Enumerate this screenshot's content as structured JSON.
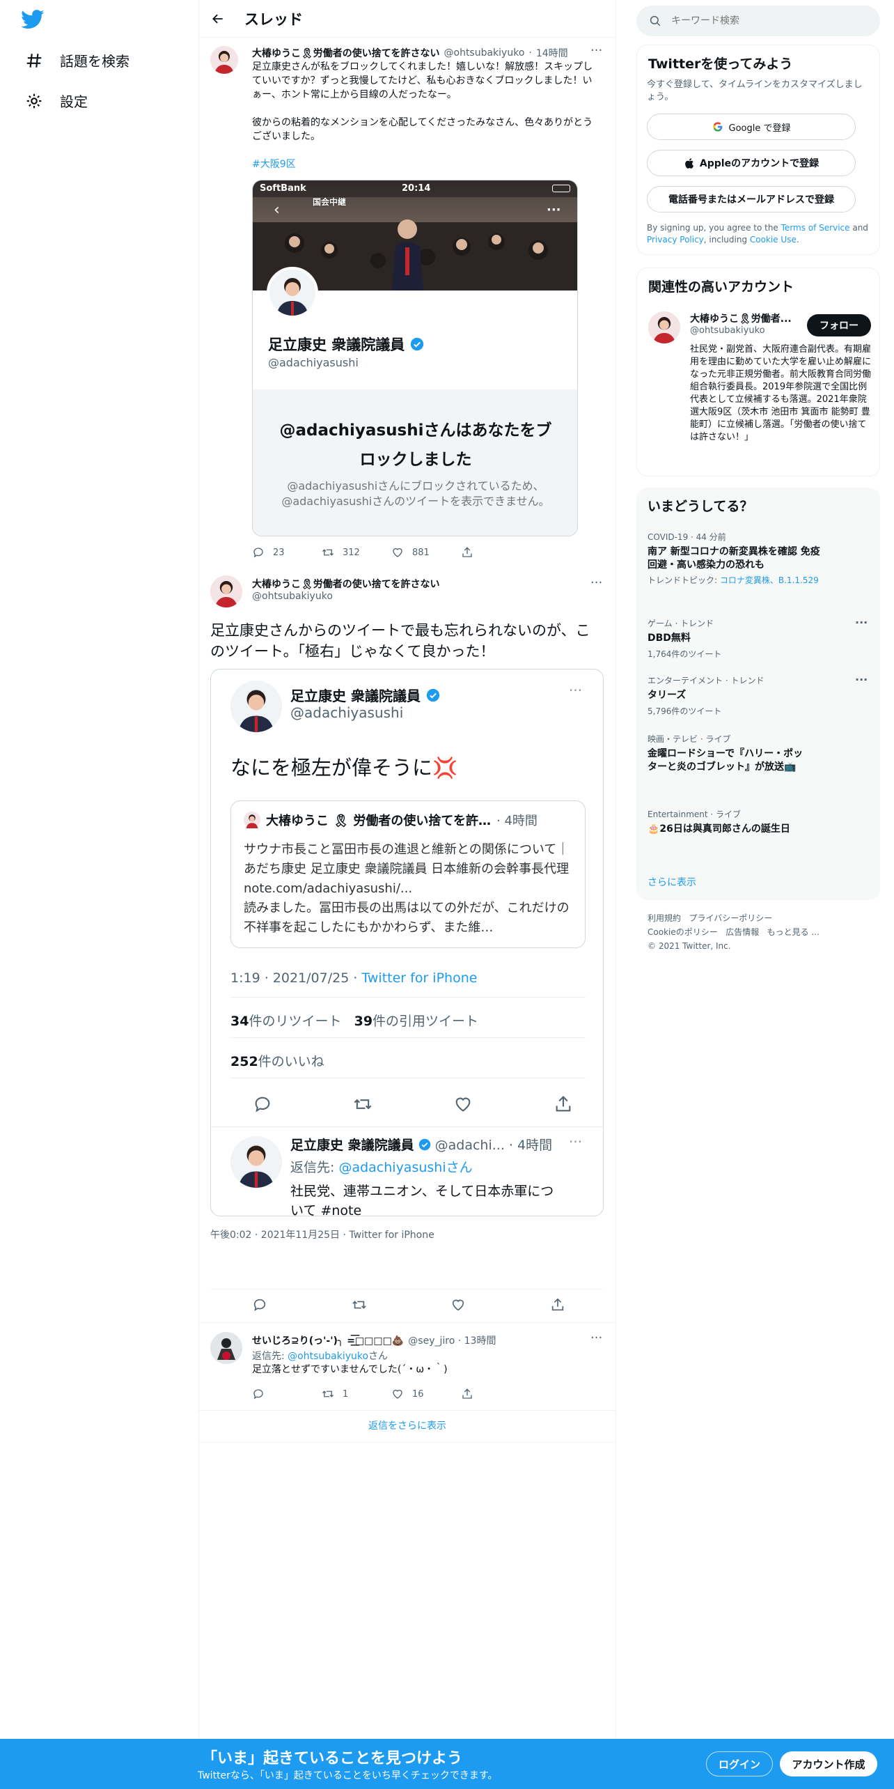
{
  "sidebar": {
    "items": [
      {
        "label": "話題を検索"
      },
      {
        "label": "設定"
      }
    ]
  },
  "header": {
    "title": "スレッド"
  },
  "tweet1": {
    "author": "大椿ゆうこ🎗労働者の使い捨てを許さない",
    "handle": "@ohtsubakiyuko",
    "time": "14時間",
    "text": "足立康史さんが私をブロックしてくれました！嬉しいな！解放感！スキップしていいですか？ずっと我慢してたけど、私も心おきなくブロックしました！いぁー、ホント常に上から目線の人だったなー。\n\n彼からの粘着的なメンションを心配してくださったみなさん、色々ありがとうございました。",
    "hashtag": "#大阪9区",
    "image": {
      "status_carrier": "SoftBank",
      "status_time": "20:14",
      "tv_label": "国会中継",
      "profile_name": "足立康史 衆議院議員",
      "profile_handle": "@adachiyasushi",
      "blocked_title": "@adachiyasushiさんはあなたをブロックしました",
      "blocked_sub": "@adachiyasushiさんにブロックされているため、@adachiyasushiさんのツイートを表示できません。"
    },
    "replies": "23",
    "retweets": "312",
    "likes": "881"
  },
  "tweet2": {
    "author": "大椿ゆうこ🎗労働者の使い捨てを許さない",
    "handle": "@ohtsubakiyuko",
    "text": "足立康史さんからのツイートで最も忘れられないのが、このツイート。「極右」じゃなくて良かった！",
    "image": {
      "name": "足立康史 衆議院議員",
      "handle": "@adachiyasushi",
      "tweet_text": "なにを極左が偉そうに💢",
      "quoted_author": "大椿ゆうこ 🎗 労働者の使い捨てを許…",
      "quoted_time": "· 4時間",
      "quoted_text": "サウナ市長こと冨田市長の進退と維新との関係について｜あだち康史 足立康史 衆議院議員 日本維新の会幹事長代理 note.com/adachiyasushi/...\n読みました。冨田市長の出馬は以ての外だが、これだけの不祥事を起こしたにもかかわらず、また維…",
      "timestamp": "1:19 · 2021/07/25 · ",
      "source": "Twitter for iPhone",
      "retweets_n": "34",
      "retweets_l": "件のリツイート",
      "quotes_n": "39",
      "quotes_l": "件の引用ツイート",
      "likes_n": "252",
      "likes_l": "件のいいね",
      "reply_name": "足立康史 衆議院議員",
      "reply_handle": "@adachi... · 4時間",
      "reply_to_l": "返信先: ",
      "reply_to": "@adachiyasushiさん",
      "reply_text": "社民党、連帯ユニオン、そして日本赤軍につ",
      "reply_text2": "いて #note"
    },
    "timestamp": "午後0:02 · 2021年11月25日 · Twitter for iPhone"
  },
  "reply1": {
    "author": "せいじろ⊇り(っ'-')╮ =͟͟͞͞□□□□💩",
    "handle": "@sey_jiro · 13時間",
    "reply_to_l": "返信先: ",
    "reply_to": "@ohtsubakiyuko",
    "reply_to_suffix": "さん",
    "text": "足立落とせずですいませんでした(´・ω・｀)",
    "retweets": "1",
    "likes": "16"
  },
  "more_replies": "返信をさらに表示",
  "search": {
    "placeholder": "キーワード検索"
  },
  "signup": {
    "title": "Twitterを使ってみよう",
    "sub": "今すぐ登録して、タイムラインをカスタマイズしましょう。",
    "google": "Google で登録",
    "apple": "Appleのアカウントで登録",
    "phone": "電話番号またはメールアドレスで登録",
    "legal1": "By signing up, you agree to the ",
    "tos": "Terms of Service",
    "legal2": " and ",
    "privacy": "Privacy Policy",
    "legal3": ", including ",
    "cookie": "Cookie Use",
    "legal4": "."
  },
  "related": {
    "title": "関連性の高いアカウント",
    "name": "大椿ゆうこ🎗労働者...",
    "handle": "@ohtsubakiyuko",
    "follow": "フォロー",
    "bio": "社民党・副党首、大阪府連合副代表。有期雇用を理由に勤めていた大学を雇い止め解雇になった元非正規労働者。前大阪教育合同労働組合執行委員長。2019年参院選で全国比例代表として立候補するも落選。2021年衆院選大阪9区（茨木市 池田市 箕面市 能勢町 豊能町）に立候補し落選。「労働者の使い捨ては許さない！」"
  },
  "trends": {
    "title": "いまどうしてる？",
    "items": [
      {
        "cat": "COVID-19 · 44 分前",
        "name": "南ア 新型コロナの新変異株を確認 免疫回避・高い感染力の恐れも",
        "sub_l": "トレンドトピック: ",
        "sub_link": "コロナ変異株、B.1.1.529"
      },
      {
        "cat": "ゲーム · トレンド",
        "name": "DBD無料",
        "sub": "1,764件のツイート"
      },
      {
        "cat": "エンターテイメント · トレンド",
        "name": "タリーズ",
        "sub": "5,796件のツイート"
      },
      {
        "cat": "映画・テレビ · ライブ",
        "name": "金曜ロードショーで『ハリー・ポッターと炎のゴブレット』が放送📺"
      },
      {
        "cat": "Entertainment · ライブ",
        "name": "🎂26日は與真司郎さんの誕生日"
      }
    ],
    "more": "さらに表示"
  },
  "footer": {
    "l1": "利用規約",
    "l2": "プライバシーポリシー",
    "l3": "Cookieのポリシー",
    "l4": "広告情報",
    "l5": "もっと見る ...",
    "copy": "© 2021 Twitter, Inc."
  },
  "bottom": {
    "title": "「いま」起きていることを見つけよう",
    "sub": "Twitterなら、「いま」起きていることをいち早くチェックできます。",
    "login": "ログイン",
    "signup": "アカウント作成"
  },
  "colors": {
    "accent": "#1d9bf0",
    "text": "#0f1419",
    "muted": "#536471"
  }
}
